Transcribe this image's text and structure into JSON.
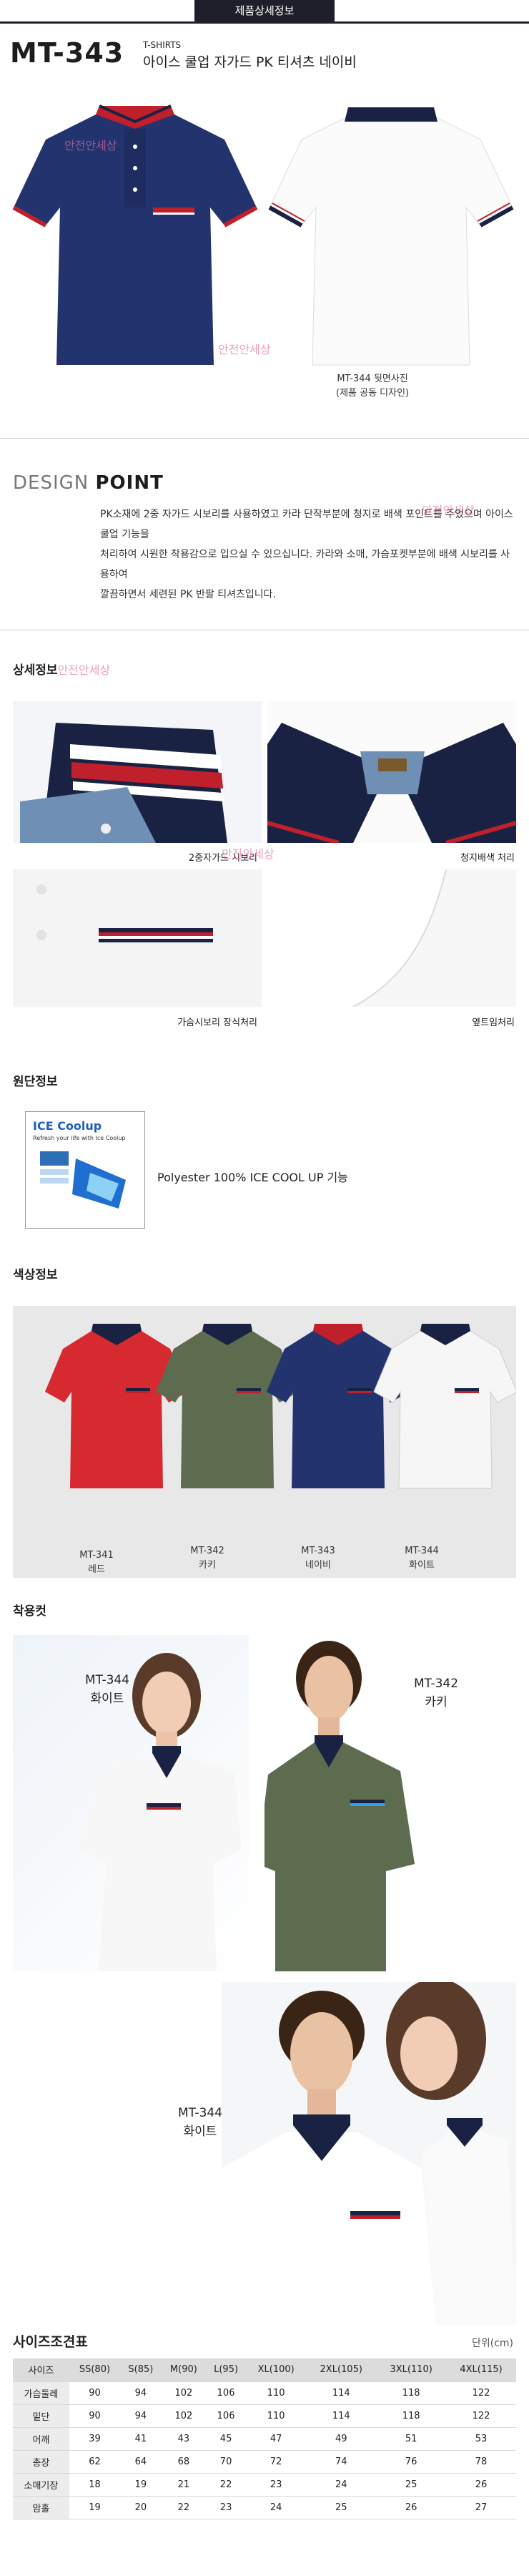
{
  "header": {
    "tab_label": "제품상세정보"
  },
  "product": {
    "model": "MT-343",
    "category": "T-SHIRTS",
    "title": "아이스 쿨업 자가드 PK 티셔츠 네이비",
    "watermark": "안전안세상",
    "hero_caption_line1": "MT-344 뒷면사진",
    "hero_caption_line2": "(제품 공동 디자인)"
  },
  "design": {
    "heading_light": "DESIGN ",
    "heading_bold": "POINT",
    "lines": [
      "PK소재에 2중 자가드 시보리를 사용하였고 카라 단작부분에 청지로 배색 포인트를 주었으며 아이스쿨업 기능을",
      "처리하여 시원한 착용감으로 입으실 수 있으십니다. 카라와 소매, 가슴포켓부분에 배색 시보리를 사용하여",
      "깔끔하면서 세련된 PK 반팔 티셔츠입니다."
    ]
  },
  "detail": {
    "heading": "상세정보",
    "captions": [
      "2중자가드 시보리",
      "청지배색 처리",
      "가슴시보리 장식처리",
      "옆트임처리"
    ]
  },
  "fabric": {
    "heading": "원단정보",
    "text": "Polyester 100%  ICE COOL UP 기능",
    "logo_title": "ICE Coolup",
    "logo_sub": "Refresh  your life with Ice Coolup"
  },
  "colors": {
    "heading": "색상정보",
    "items": [
      {
        "code": "MT-341",
        "name": "레드",
        "body": "#d62a30",
        "collar": "#1a2244"
      },
      {
        "code": "MT-342",
        "name": "카키",
        "body": "#5d6b4e",
        "collar": "#1a2244"
      },
      {
        "code": "MT-343",
        "name": "네이비",
        "body": "#23336e",
        "collar": "#c01f2c"
      },
      {
        "code": "MT-344",
        "name": "화이트",
        "body": "#f6f6f6",
        "collar": "#1a2244"
      }
    ]
  },
  "wearing": {
    "heading": "착용컷",
    "labels": [
      {
        "code": "MT-344",
        "name": "화이트"
      },
      {
        "code": "MT-342",
        "name": "카키"
      },
      {
        "code": "MT-344",
        "name": "화이트"
      }
    ]
  },
  "size": {
    "heading": "사이즈조견표",
    "unit": "단위(cm)",
    "columns": [
      "사이즈",
      "SS(80)",
      "S(85)",
      "M(90)",
      "L(95)",
      "XL(100)",
      "2XL(105)",
      "3XL(110)",
      "4XL(115)"
    ],
    "rows": [
      [
        "가슴둘레",
        "90",
        "94",
        "102",
        "106",
        "110",
        "114",
        "118",
        "122"
      ],
      [
        "밑단",
        "90",
        "94",
        "102",
        "106",
        "110",
        "114",
        "118",
        "122"
      ],
      [
        "어깨",
        "39",
        "41",
        "43",
        "45",
        "47",
        "49",
        "51",
        "53"
      ],
      [
        "총장",
        "62",
        "64",
        "68",
        "70",
        "72",
        "74",
        "76",
        "78"
      ],
      [
        "소매기장",
        "18",
        "19",
        "21",
        "22",
        "23",
        "24",
        "25",
        "26"
      ],
      [
        "암홀",
        "19",
        "20",
        "22",
        "23",
        "24",
        "25",
        "26",
        "27"
      ]
    ]
  }
}
